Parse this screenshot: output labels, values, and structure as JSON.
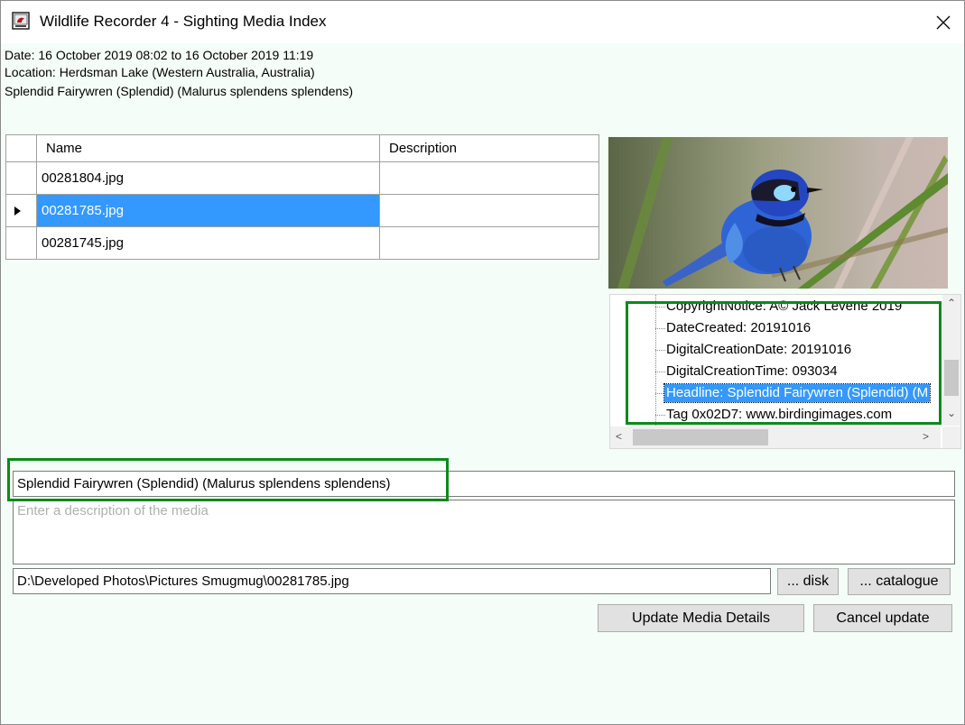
{
  "window": {
    "title": "Wildlife Recorder 4 - Sighting Media Index",
    "close_glyph": "✕"
  },
  "sighting": {
    "date": "Date: 16 October 2019 08:02 to 16 October 2019 11:19",
    "location": "Location: Herdsman Lake (Western Australia, Australia)",
    "species": "Splendid Fairywren (Splendid) (Malurus splendens splendens)"
  },
  "media_table": {
    "columns": [
      "Name",
      "Description"
    ],
    "rows": [
      {
        "name": "00281804.jpg",
        "description": ""
      },
      {
        "name": "00281785.jpg",
        "description": ""
      },
      {
        "name": "00281745.jpg",
        "description": ""
      }
    ],
    "selected_index": 1
  },
  "metadata_tree": {
    "items": [
      "CopyrightNotice: A© Jack Levene 2019",
      "DateCreated: 20191016",
      "DigitalCreationDate: 20191016",
      "DigitalCreationTime: 093034",
      "Headline: Splendid Fairywren (Splendid) (M",
      "Tag 0x02D7: www.birdingimages.com"
    ],
    "selected_index": 4
  },
  "form": {
    "title_value": "Splendid Fairywren (Splendid) (Malurus splendens splendens)",
    "description_value": "",
    "description_placeholder": "Enter a description of the media",
    "path_value": "D:\\Developed Photos\\Pictures Smugmug\\00281785.jpg",
    "disk_button": "... disk",
    "catalogue_button": "... catalogue",
    "update_button": "Update Media Details",
    "cancel_button": "Cancel update"
  },
  "colors": {
    "selection": "#3399ff",
    "highlight_box": "#0b8a1a",
    "background": "#f5fdf8"
  }
}
